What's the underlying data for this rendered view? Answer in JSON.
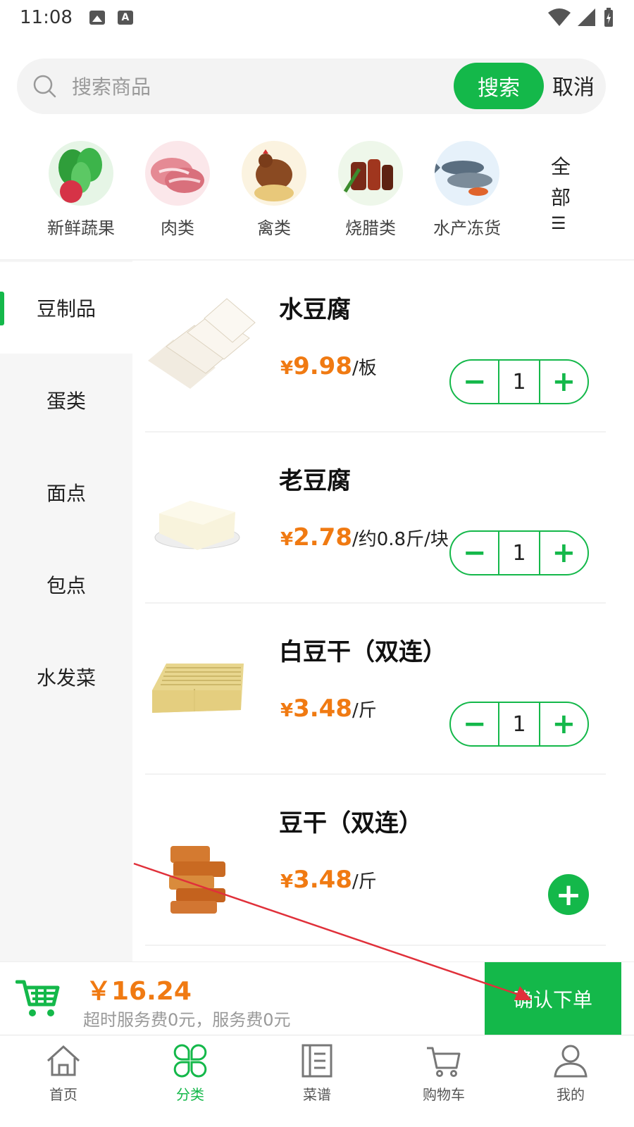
{
  "status_bar": {
    "time": "11:08"
  },
  "search": {
    "placeholder": "搜索商品",
    "button_label": "搜索",
    "cancel_label": "取消"
  },
  "categories": [
    {
      "label": "新鲜蔬果",
      "icon": "vegetables-icon"
    },
    {
      "label": "肉类",
      "icon": "meat-icon"
    },
    {
      "label": "禽类",
      "icon": "poultry-icon"
    },
    {
      "label": "烧腊类",
      "icon": "roast-meat-icon"
    },
    {
      "label": "水产冻货",
      "icon": "seafood-icon"
    }
  ],
  "categories_all_label": "全部",
  "side_menu": [
    {
      "label": "豆制品",
      "active": true
    },
    {
      "label": "蛋类",
      "active": false
    },
    {
      "label": "面点",
      "active": false
    },
    {
      "label": "包点",
      "active": false
    },
    {
      "label": "水发菜",
      "active": false
    }
  ],
  "products": [
    {
      "name": "水豆腐",
      "price_symbol": "¥",
      "price": "9.98",
      "unit": "/板",
      "quantity": "1",
      "in_cart": true
    },
    {
      "name": "老豆腐",
      "price_symbol": "¥",
      "price": "2.78",
      "unit": "/约0.8斤/块",
      "quantity": "1",
      "in_cart": true
    },
    {
      "name": "白豆干（双连）",
      "price_symbol": "¥",
      "price": "3.48",
      "unit": "/斤",
      "quantity": "1",
      "in_cart": true
    },
    {
      "name": "豆干（双连）",
      "price_symbol": "¥",
      "price": "3.48",
      "unit": "/斤",
      "in_cart": false
    }
  ],
  "stepper_labels": {
    "minus": "−",
    "plus": "+"
  },
  "checkout": {
    "total": "￥16.24",
    "fee_note": "超时服务费0元，服务费0元",
    "confirm_label": "确认下单"
  },
  "tabs": [
    {
      "label": "首页",
      "icon": "home-icon",
      "active": false
    },
    {
      "label": "分类",
      "icon": "category-icon",
      "active": true
    },
    {
      "label": "菜谱",
      "icon": "recipe-book-icon",
      "active": false
    },
    {
      "label": "购物车",
      "icon": "cart-icon",
      "active": false
    },
    {
      "label": "我的",
      "icon": "profile-icon",
      "active": false
    }
  ],
  "colors": {
    "accent": "#14b84a",
    "price": "#f07a12",
    "annotation": "#e0303a"
  }
}
